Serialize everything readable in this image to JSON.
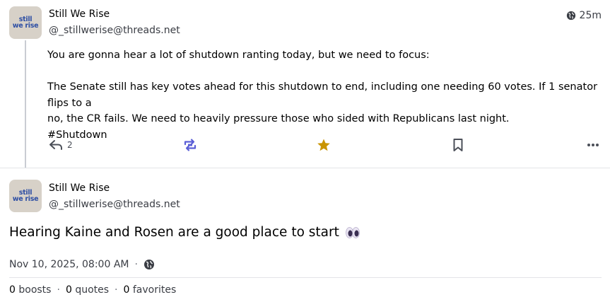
{
  "status1": {
    "avatar_text": [
      "still",
      "we rise"
    ],
    "display_name": "Still We Rise",
    "account": "@_stillwerise@threads.net",
    "time": "25m",
    "paragraph1": "You are gonna hear a lot of shutdown ranting today, but we need to focus:",
    "paragraph2_line1": "The Senate still has key votes ahead for this shutdown to end, including one needing 60 votes. If 1 senator flips to a",
    "paragraph2_line2": "no, the CR fails. We need to heavily pressure those who sided with Republicans last night.",
    "hashtag": "#Shutdown",
    "reply_count": "2",
    "icons": {
      "reply": "reply-icon",
      "boost": "boost-icon",
      "favourite": "star-icon",
      "bookmark": "bookmark-icon",
      "more": "more-icon",
      "visibility": "globe-icon"
    },
    "colors": {
      "boost_active": "#5b5fd6",
      "favourite_active": "#c99400"
    }
  },
  "status2": {
    "avatar_text": [
      "still",
      "we rise"
    ],
    "display_name": "Still We Rise",
    "account": "@_stillwerise@threads.net",
    "content": "Hearing Kaine and Rosen are a good place to start",
    "emoji": "eyes-emoji",
    "date": "Nov 10, 2025, 08:00 AM",
    "visibility_icon": "globe-icon",
    "boosts_count": "0",
    "boosts_label": "boosts",
    "quotes_count": "0",
    "quotes_label": "quotes",
    "favorites_count": "0",
    "favorites_label": "favorites"
  }
}
